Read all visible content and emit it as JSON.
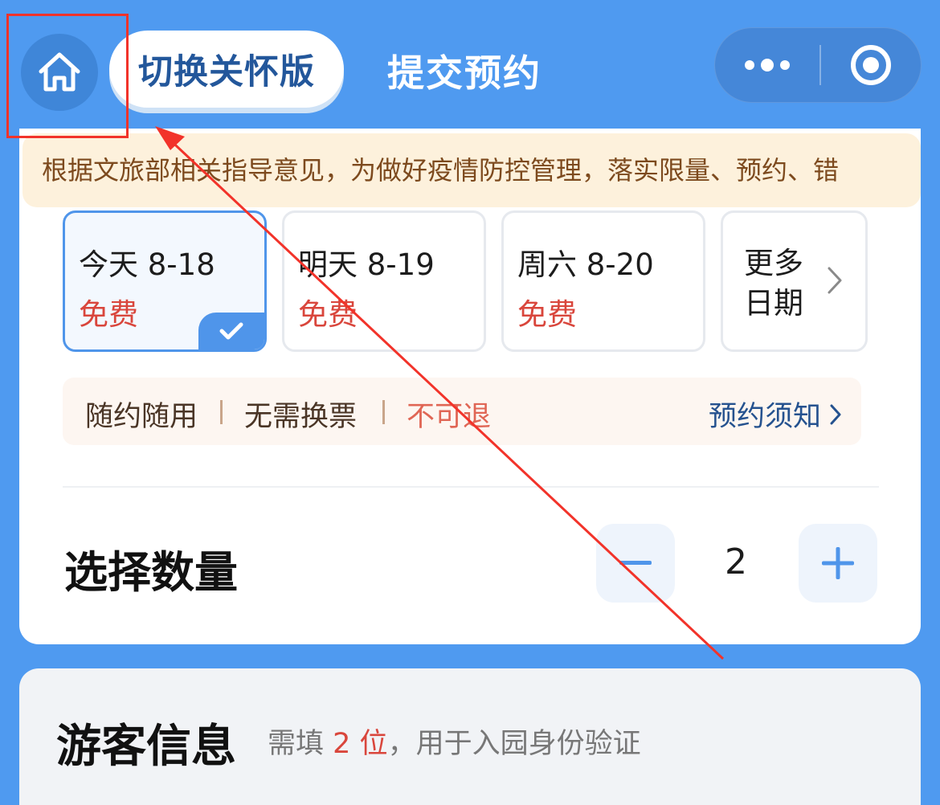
{
  "header": {
    "care_mode_label": "切换关怀版",
    "title": "提交预约"
  },
  "notice": "根据文旅部相关指导意见，为做好疫情防控管理，落实限量、预约、错",
  "dates": [
    {
      "label": "今天 8-18",
      "price": "免费",
      "selected": true
    },
    {
      "label": "明天 8-19",
      "price": "免费",
      "selected": false
    },
    {
      "label": "周六 8-20",
      "price": "免费",
      "selected": false
    }
  ],
  "more_dates_label": "更多日期",
  "policy": {
    "items": [
      "随约随用",
      "无需换票",
      "不可退"
    ],
    "notice_link": "预约须知"
  },
  "quantity": {
    "title": "选择数量",
    "value": "2"
  },
  "visitor": {
    "title": "游客信息",
    "hint_prefix": "需填",
    "hint_count": "2 位",
    "hint_suffix": "，用于入园身份验证"
  },
  "colors": {
    "primary_blue": "#4f9af0",
    "price_red": "#d9463c",
    "annotation_red": "#f2332a"
  },
  "icons": [
    "home-icon",
    "more-dots-icon",
    "close-circle-icon",
    "check-icon",
    "chevron-right-icon",
    "minus-icon",
    "plus-icon"
  ]
}
